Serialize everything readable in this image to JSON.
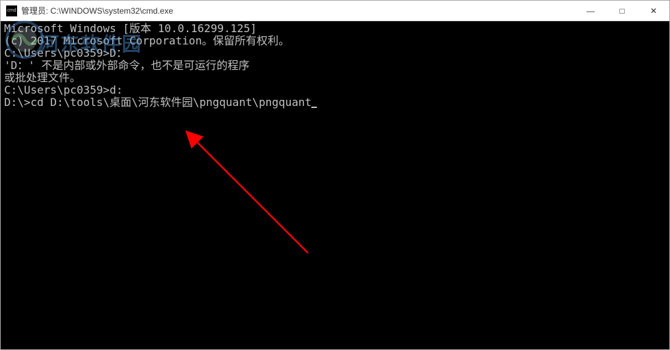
{
  "titlebar": {
    "icon_label": "cmd",
    "title": "管理员: C:\\WINDOWS\\system32\\cmd.exe"
  },
  "window_controls": {
    "minimize": "—",
    "maximize": "□",
    "close": "✕"
  },
  "terminal": {
    "line1": "Microsoft Windows [版本 10.0.16299.125]",
    "line2": "(c) 2017 Microsoft Corporation。保留所有权利。",
    "line3": "",
    "line4": "C:\\Users\\pc0359>D：",
    "line5": "'D：' 不是内部或外部命令，也不是可运行的程序",
    "line6": "或批处理文件。",
    "line7": "",
    "line8": "C:\\Users\\pc0359>d:",
    "line9": "",
    "line10": "D:\\>cd D:\\tools\\桌面\\河东软件园\\pngquant\\pngquant"
  },
  "watermark": {
    "text": "河东软件园"
  }
}
